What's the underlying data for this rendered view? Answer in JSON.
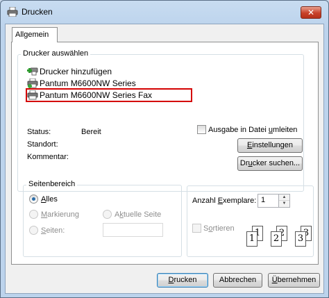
{
  "window": {
    "title": "Drucken",
    "close_glyph": "✕"
  },
  "tabs": [
    {
      "label": "Allgemein"
    }
  ],
  "printer_group": {
    "legend": "Drucker auswählen",
    "printers": [
      {
        "label": "Drucker hinzufügen",
        "icon": "add-printer-icon"
      },
      {
        "label": "Pantum M6600NW Series",
        "icon": "printer-icon"
      },
      {
        "label": "Pantum M6600NW Series Fax",
        "icon": "fax-printer-icon",
        "selected": true
      }
    ],
    "status_label": "Status:",
    "status_value": "Bereit",
    "location_label": "Standort:",
    "location_value": "",
    "comment_label": "Kommentar:",
    "comment_value": "",
    "print_to_file": {
      "prefix": "Ausgabe in Datei ",
      "accel": "u",
      "suffix": "mleiten",
      "checked": false
    },
    "settings_button": {
      "accel": "E",
      "rest": "instellungen"
    },
    "find_button": {
      "prefix": "Dr",
      "accel": "u",
      "suffix": "cker suchen..."
    }
  },
  "range_group": {
    "legend": "Seitenbereich",
    "all": {
      "accel": "A",
      "rest": "lles",
      "checked": true
    },
    "selection": {
      "accel": "M",
      "rest": "arkierung"
    },
    "current": {
      "prefix": "A",
      "accel": "k",
      "suffix": "tuelle Seite"
    },
    "pages": {
      "accel": "S",
      "rest": "eiten:",
      "value": ""
    }
  },
  "copies_group": {
    "copies_label_prefix": "Anzahl ",
    "copies_label_accel": "E",
    "copies_label_suffix": "xemplare:",
    "copies_value": "1",
    "collate": {
      "prefix": "S",
      "accel": "o",
      "suffix": "rtieren",
      "checked": false
    },
    "collate_pages": [
      "1",
      "1",
      "2",
      "2",
      "3",
      "3"
    ]
  },
  "buttons": {
    "print": {
      "accel": "D",
      "rest": "rucken"
    },
    "cancel": {
      "label": "Abbrechen"
    },
    "apply": {
      "accel": "Ü",
      "rest": "bernehmen"
    }
  }
}
